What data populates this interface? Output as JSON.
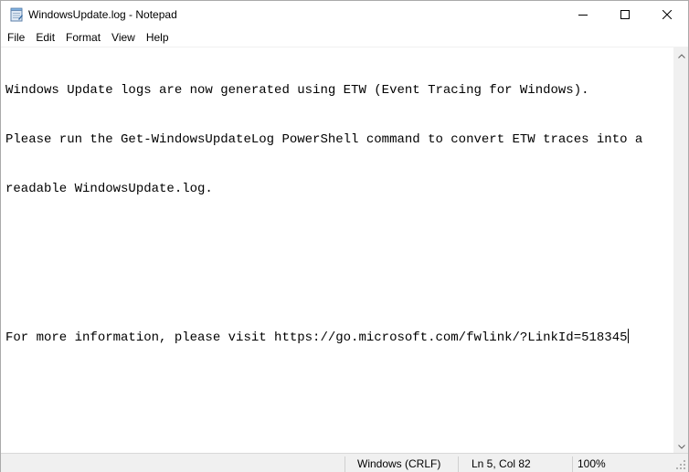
{
  "window": {
    "title": "WindowsUpdate.log - Notepad",
    "icon": "notepad-icon",
    "controls": [
      "minimize-icon",
      "maximize-icon",
      "close-icon"
    ]
  },
  "menu": {
    "items": [
      {
        "label": "File"
      },
      {
        "label": "Edit"
      },
      {
        "label": "Format"
      },
      {
        "label": "View"
      },
      {
        "label": "Help"
      }
    ]
  },
  "document": {
    "lines": [
      "Windows Update logs are now generated using ETW (Event Tracing for Windows).",
      "Please run the Get-WindowsUpdateLog PowerShell command to convert ETW traces into a",
      "readable WindowsUpdate.log.",
      "",
      "",
      "For more information, please visit https://go.microsoft.com/fwlink/?LinkId=518345"
    ]
  },
  "statusbar": {
    "line_ending": "Windows (CRLF)",
    "position": "Ln 5, Col 82",
    "zoom": "100%"
  }
}
